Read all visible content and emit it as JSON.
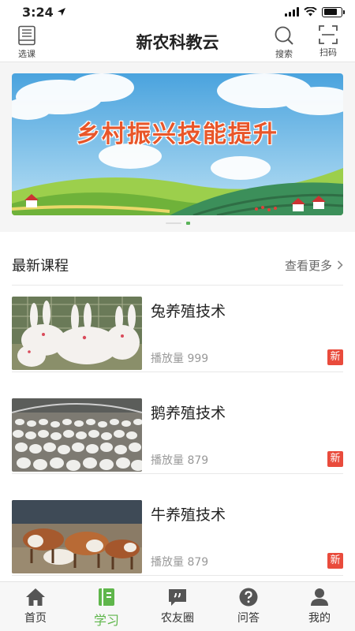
{
  "status_bar": {
    "time": "3:24"
  },
  "header": {
    "title": "新农科教云",
    "left_btn": {
      "label": "选课",
      "icon": "book-icon"
    },
    "search_btn": {
      "label": "搜索",
      "icon": "search-icon"
    },
    "scan_btn": {
      "label": "扫码",
      "icon": "scan-icon"
    }
  },
  "banner": {
    "text": "乡村振兴技能提升",
    "pages": 2,
    "active_page": 2
  },
  "section": {
    "title": "最新课程",
    "more_label": "查看更多"
  },
  "courses": [
    {
      "title": "兔养殖技术",
      "plays": "播放量 999",
      "badge": "新"
    },
    {
      "title": "鹅养殖技术",
      "plays": "播放量 879",
      "badge": "新"
    },
    {
      "title": "牛养殖技术",
      "plays": "播放量 879",
      "badge": "新"
    }
  ],
  "tabbar": {
    "tabs": [
      {
        "label": "首页",
        "icon": "home-icon"
      },
      {
        "label": "学习",
        "icon": "study-icon",
        "active": true
      },
      {
        "label": "农友圈",
        "icon": "chat-quote-icon"
      },
      {
        "label": "问答",
        "icon": "question-icon"
      },
      {
        "label": "我的",
        "icon": "user-icon"
      }
    ]
  },
  "colors": {
    "accent": "#5fb64b",
    "badge": "#e94b3c",
    "banner_text": "#e8562a"
  }
}
